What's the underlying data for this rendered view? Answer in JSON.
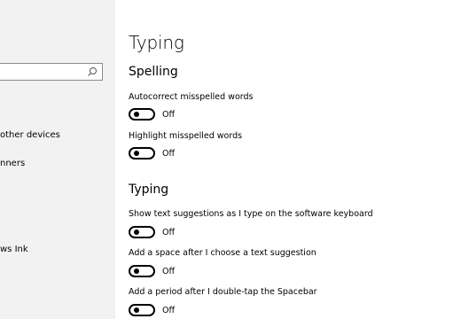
{
  "sidebar": {
    "search_placeholder": "",
    "items": [
      {
        "label": "other devices"
      },
      {
        "label": "nners"
      },
      {
        "label": "ws Ink"
      }
    ]
  },
  "main": {
    "title": "Typing",
    "sections": [
      {
        "title": "Spelling",
        "settings": [
          {
            "label": "Autocorrect misspelled words",
            "state": "Off"
          },
          {
            "label": "Highlight misspelled words",
            "state": "Off"
          }
        ]
      },
      {
        "title": "Typing",
        "settings": [
          {
            "label": "Show text suggestions as I type on the software keyboard",
            "state": "Off"
          },
          {
            "label": "Add a space after I choose a text suggestion",
            "state": "Off"
          },
          {
            "label": "Add a period after I double-tap the Spacebar",
            "state": "Off"
          }
        ]
      }
    ]
  }
}
